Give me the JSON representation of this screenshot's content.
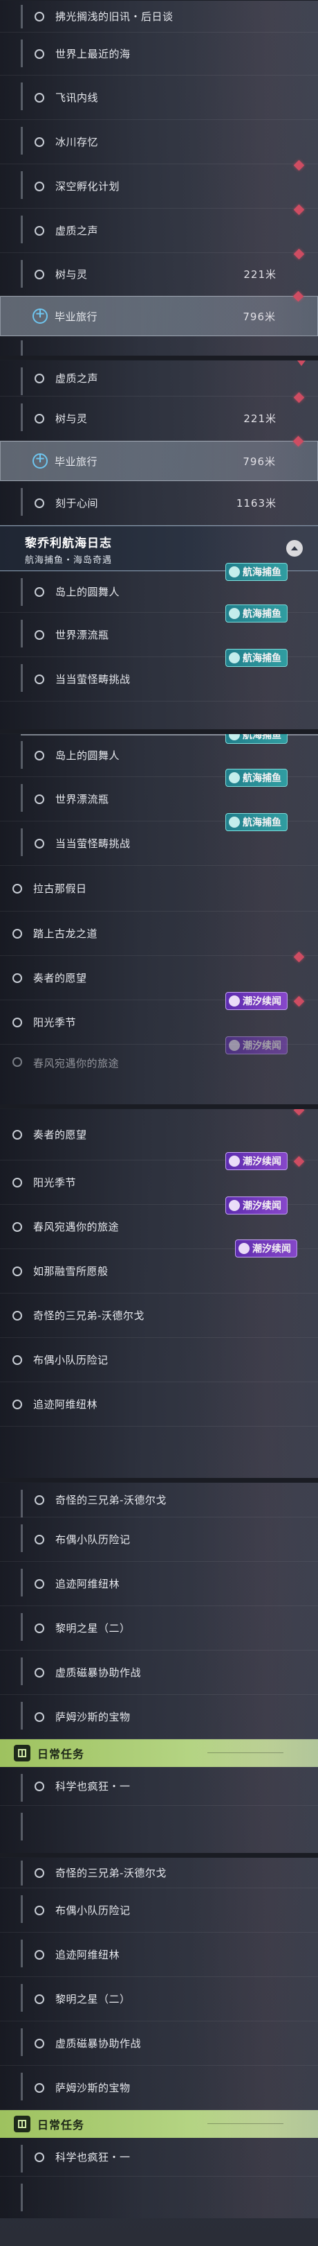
{
  "quests": {
    "fuguang": "拂光搁浅的旧讯・后日谈",
    "worldsea": "世界上最近的海",
    "flight": "飞讯内线",
    "ice": "冰川存忆",
    "deepspace": "深空孵化计划",
    "voidsound": "虚质之声",
    "treespirit": "树与灵",
    "graduation": "毕业旅行",
    "momentheart": "刻于心间",
    "island": "岛上的圆舞人",
    "drift": "世界漂流瓶",
    "strange": "当当萤怪畴挑战",
    "lata": "拉古那假日",
    "dragon": "踏上古龙之道",
    "playerwish": "奏者的愿望",
    "sunfest": "阳光季节",
    "springwind": "春风宛遇你的旅途",
    "bloomsky": "如那融雪所愿般",
    "siblings": "奇怪的三兄弟-沃德尔戈",
    "dolls": "布偶小队历险记",
    "chase": "追迹阿维纽林",
    "dawnstar": "黎明之星（二）",
    "voidstorm": "虚质磁暴协助作战",
    "sasha": "萨姆沙斯的宝物",
    "science": "科学也疯狂・一"
  },
  "distances": {
    "tree": "221米",
    "graduation": "796米",
    "heart": "1163米"
  },
  "header": {
    "title": "黎乔利航海日志",
    "subtitle": "航海捕鱼・海岛奇遇"
  },
  "tags": {
    "fishing": "航海捕鱼",
    "tide": "潮汐续闻"
  },
  "daily": {
    "title": "日常任务"
  },
  "colors": {
    "marker": "#e04d63",
    "active_ring": "#6fc6f0",
    "daily_bar": "#9ec25f",
    "tag_teal": "#2aa6a8",
    "tag_purple": "#8b46d6"
  }
}
